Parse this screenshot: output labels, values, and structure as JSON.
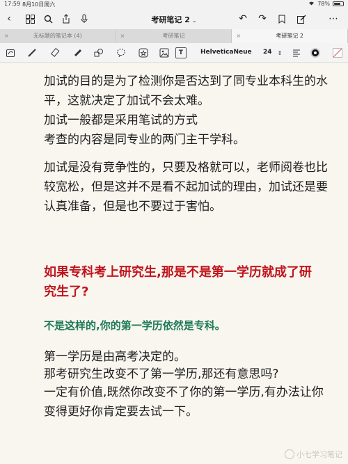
{
  "status_bar": {
    "time": "17:59",
    "date": "8月10日周六",
    "wifi_icon": "wifi-icon",
    "battery": "78%",
    "battery_level": 0.78
  },
  "nav": {
    "title": "考研笔记 2",
    "chevron": "⌄"
  },
  "tabs": [
    {
      "label": "无标题的笔记本 (4)",
      "close": "×"
    },
    {
      "label": "考研笔记",
      "close": "×"
    },
    {
      "label": "考研笔记 2",
      "close": "×"
    }
  ],
  "toolbar": {
    "font_name": "HelveticaNeue",
    "font_size": "24",
    "text_tool": "T"
  },
  "note": {
    "paragraphs": [
      "加试的目的是为了检测你是否达到了同专业本科生的水平，这就决定了加试不会太难。",
      "加试一般都是采用笔试的方式",
      "考查的内容是同专业的两门主干学科。",
      "加试是没有竞争性的，只要及格就可以，老师阅卷也比较宽松，但是这并不是看不起加试的理由，加试还是要认真准备，但是也不要过于害怕。"
    ],
    "heading_red": "如果专科考上研究生,那是不是第一学历就成了研究生了?",
    "heading_green": "不是这样的,你的第一学历依然是专科。",
    "closing": [
      "第一学历是由高考决定的。",
      "那考研究生改变不了第一学历,那还有意思吗?",
      "一定有价值,既然你改变不了你的第一学历,有办法让你变得更好你肯定要去试一下。"
    ]
  },
  "watermark": "小七学习笔记",
  "colors": {
    "red_heading": "#c0141c",
    "green_heading": "#1f7a5a"
  }
}
